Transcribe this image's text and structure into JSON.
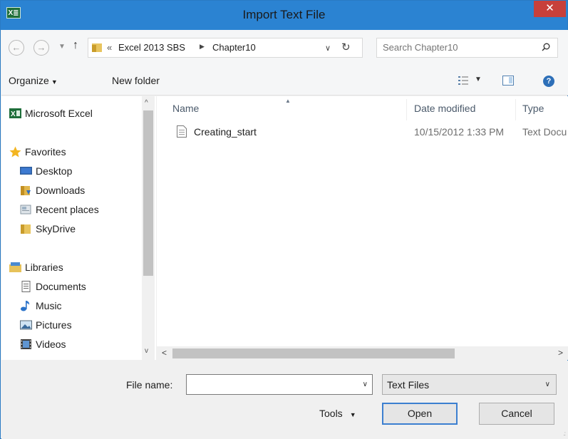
{
  "window": {
    "title": "Import Text File",
    "app_icon_text": "X≣",
    "close_label": "✕"
  },
  "address": {
    "overflow": "«",
    "crumbs": [
      "Excel 2013 SBS",
      "Chapter10"
    ],
    "search_placeholder": "Search Chapter10"
  },
  "toolbar": {
    "organize_label": "Organize",
    "new_folder_label": "New folder"
  },
  "sidebar": {
    "items": [
      {
        "label": "Microsoft Excel",
        "icon": "excel-icon"
      },
      {
        "label": "Favorites",
        "icon": "star-icon"
      },
      {
        "label": "Desktop",
        "icon": "desktop-icon"
      },
      {
        "label": "Downloads",
        "icon": "downloads-icon"
      },
      {
        "label": "Recent places",
        "icon": "recent-places-icon"
      },
      {
        "label": "SkyDrive",
        "icon": "skydrive-icon"
      },
      {
        "label": "Libraries",
        "icon": "libraries-icon"
      },
      {
        "label": "Documents",
        "icon": "documents-icon"
      },
      {
        "label": "Music",
        "icon": "music-icon"
      },
      {
        "label": "Pictures",
        "icon": "pictures-icon"
      },
      {
        "label": "Videos",
        "icon": "videos-icon"
      }
    ]
  },
  "filelist": {
    "columns": [
      "Name",
      "Date modified",
      "Type"
    ],
    "rows": [
      {
        "name": "Creating_start",
        "date": "10/15/2012 1:33 PM",
        "type": "Text Docu"
      }
    ]
  },
  "bottom": {
    "file_name_label": "File name:",
    "file_name_value": "",
    "file_type": "Text Files",
    "tools_label": "Tools",
    "open_label": "Open",
    "cancel_label": "Cancel"
  },
  "colors": {
    "titlebar": "#2b83d2",
    "close": "#c7403b",
    "accent": "#3c7fd0"
  }
}
